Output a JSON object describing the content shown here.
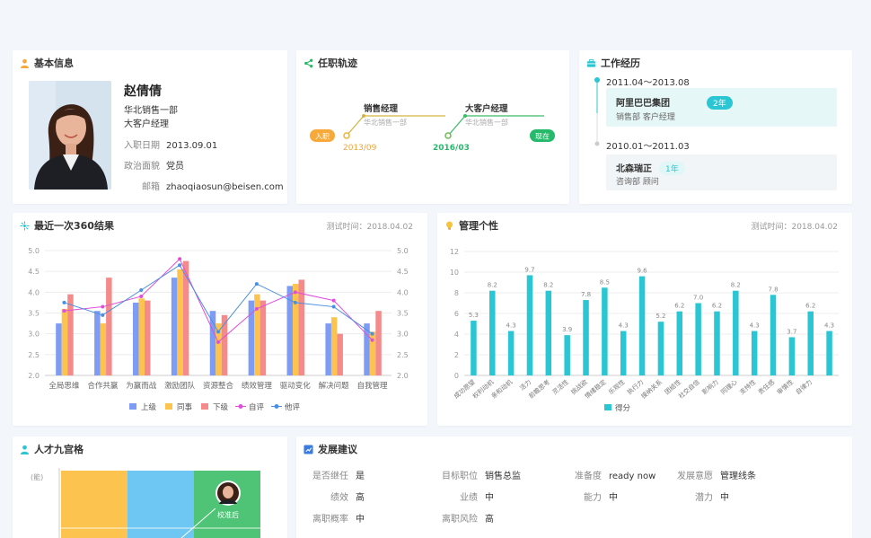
{
  "basic": {
    "title": "基本信息",
    "name": "赵倩倩",
    "department": "华北销售一部",
    "position": "大客户经理",
    "fields": [
      {
        "key": "入职日期",
        "value": "2013.09.01"
      },
      {
        "key": "政治面貌",
        "value": "党员"
      },
      {
        "key": "邮箱",
        "value": "zhaoqiaosun@beisen.com"
      }
    ]
  },
  "career": {
    "title": "任职轨迹",
    "start_label": "入职",
    "end_label": "现在",
    "milestones": [
      {
        "date": "2013/09",
        "role": "销售经理",
        "dept": "华北销售一部"
      },
      {
        "date": "2016/03",
        "role": "大客户经理",
        "dept": "华北销售一部"
      }
    ]
  },
  "experience": {
    "title": "工作经历",
    "items": [
      {
        "period": "2011.04～2013.08",
        "company": "阿里巴巴集团",
        "detail": "销售部  客户经理",
        "duration": "2年"
      },
      {
        "period": "2010.01～2011.03",
        "company": "北森瑞正",
        "detail": "咨询部    顾问",
        "duration": "1年"
      }
    ]
  },
  "review360": {
    "title": "最近一次360结果",
    "meta": "测试时间：2018.04.02",
    "chart_data": {
      "type": "bar",
      "categories": [
        "全局思维",
        "合作共赢",
        "为赢而战",
        "激励团队",
        "资源整合",
        "绩效管理",
        "驱动变化",
        "解决问题",
        "自我管理"
      ],
      "ylim": [
        2.0,
        5.0
      ],
      "yticks": [
        "2.0",
        "2.5",
        "3.0",
        "3.5",
        "4.0",
        "4.5",
        "5.0"
      ],
      "series": [
        {
          "name": "上级",
          "kind": "bar",
          "color": "#7f9cf5",
          "values": [
            3.25,
            3.55,
            3.75,
            4.35,
            3.55,
            3.8,
            4.15,
            3.25,
            3.25
          ]
        },
        {
          "name": "同事",
          "kind": "bar",
          "color": "#fcc44f",
          "values": [
            3.6,
            3.25,
            3.85,
            4.55,
            3.25,
            3.95,
            4.2,
            3.4,
            3.05
          ]
        },
        {
          "name": "下级",
          "kind": "bar",
          "color": "#f48a8a",
          "values": [
            3.95,
            4.35,
            3.8,
            4.75,
            3.45,
            3.8,
            4.3,
            3.0,
            3.55
          ]
        },
        {
          "name": "自评",
          "kind": "line",
          "color": "#e04fd8",
          "values": [
            3.55,
            3.65,
            3.9,
            4.8,
            2.8,
            3.6,
            4.0,
            3.8,
            2.85
          ]
        },
        {
          "name": "他评",
          "kind": "line",
          "color": "#4a90e2",
          "values": [
            3.75,
            3.45,
            4.05,
            4.65,
            3.05,
            4.2,
            3.75,
            3.65,
            3.0
          ]
        }
      ]
    }
  },
  "personality": {
    "title": "管理个性",
    "meta": "测试时间：2018.04.02",
    "chart_data": {
      "type": "bar",
      "categories": [
        "成功愿望",
        "权利动机",
        "亲和动机",
        "活力",
        "前瞻思考",
        "灵活性",
        "挑战欲",
        "情绪稳定",
        "乐观性",
        "执行力",
        "接纳关系",
        "团结性",
        "社交自信",
        "影响力",
        "同理心",
        "支持性",
        "责任感",
        "审慎性",
        "自律力"
      ],
      "values": [
        5.3,
        8.2,
        4.3,
        9.7,
        8.2,
        3.9,
        7.3,
        8.5,
        4.3,
        9.6,
        5.2,
        6.2,
        7.0,
        6.2,
        8.2,
        4.3,
        7.8,
        3.7,
        6.2,
        4.3
      ],
      "labels": [
        "5.3",
        "8.2",
        "4.3",
        "9.7",
        "8.2",
        "3.9",
        "7.8",
        "8.5",
        "4.3",
        "9.6",
        "5.2",
        "6.2",
        "7.0",
        "6.2",
        "8.2",
        "4.3",
        "7.8",
        "3.7",
        "6.2",
        "4.3"
      ],
      "ylim": [
        0,
        12
      ],
      "yticks": [
        "0",
        "2",
        "4",
        "6",
        "8",
        "10",
        "12"
      ],
      "legend": "得分",
      "color": "#2bc6d3"
    }
  },
  "ninebox": {
    "title": "人才九宫格",
    "axis_label": "(能)",
    "person": "校准后"
  },
  "advice": {
    "title": "发展建议",
    "rows": [
      [
        {
          "k": "是否继任",
          "v": "是"
        },
        {
          "k": "目标职位",
          "v": "销售总监"
        },
        {
          "k": "准备度",
          "v": "ready now"
        },
        {
          "k": "发展意愿",
          "v": "管理线条"
        }
      ],
      [
        {
          "k": "绩效",
          "v": "高"
        },
        {
          "k": "业绩",
          "v": "中"
        },
        {
          "k": "能力",
          "v": "中"
        },
        {
          "k": "潜力",
          "v": "中"
        }
      ],
      [
        {
          "k": "离职概率",
          "v": "中"
        },
        {
          "k": "离职风险",
          "v": "高"
        }
      ]
    ]
  },
  "colors": {
    "accent": "#2bc6d3",
    "green": "#27b96b",
    "orange": "#f7a93a"
  }
}
